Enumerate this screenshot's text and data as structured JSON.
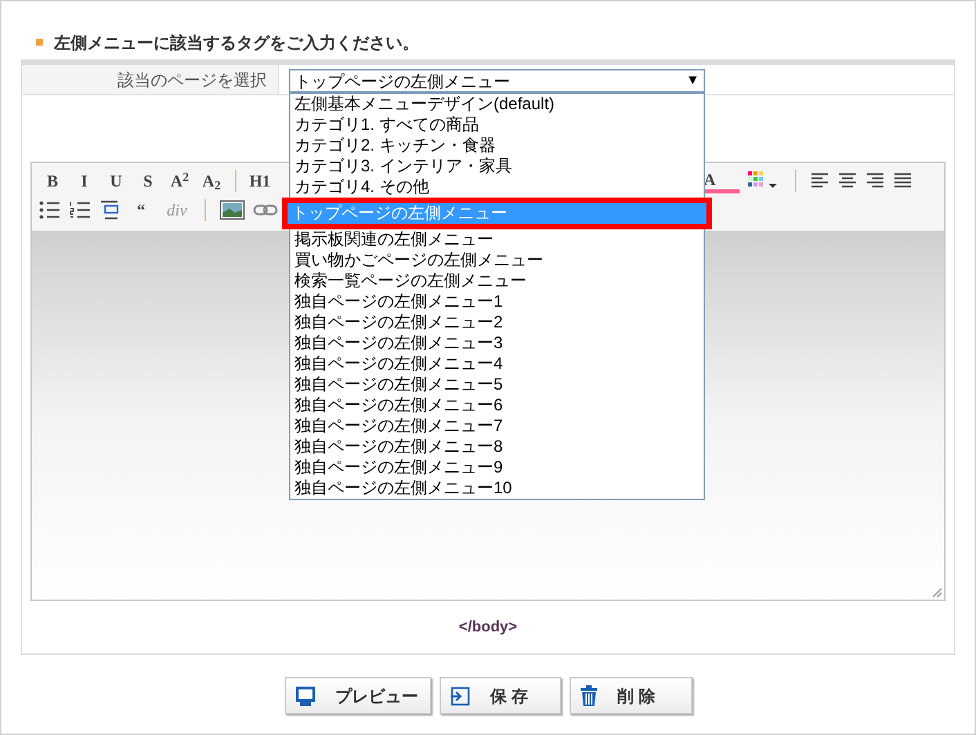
{
  "heading": "左側メニューに該当するタグをご入力ください。",
  "page_select": {
    "label": "該当のページを選択",
    "value": "トップページの左側メニュー",
    "arrow": "▼",
    "expanded": true,
    "options": [
      {
        "label": "左側基本メニューデザイン(default)",
        "selected": false
      },
      {
        "label": "カテゴリ1. すべての商品",
        "selected": false
      },
      {
        "label": "カテゴリ2. キッチン・食器",
        "selected": false
      },
      {
        "label": "カテゴリ3. インテリア・家具",
        "selected": false
      },
      {
        "label": "カテゴリ4. その他",
        "selected": false
      },
      {
        "label": "トップページの左側メニュー",
        "selected": true
      },
      {
        "label": "掲示板関連の左側メニュー",
        "selected": false
      },
      {
        "label": "買い物かごページの左側メニュー",
        "selected": false
      },
      {
        "label": "検索一覧ページの左側メニュー",
        "selected": false
      },
      {
        "label": "独自ページの左側メニュー1",
        "selected": false
      },
      {
        "label": "独自ページの左側メニュー2",
        "selected": false
      },
      {
        "label": "独自ページの左側メニュー3",
        "selected": false
      },
      {
        "label": "独自ページの左側メニュー4",
        "selected": false
      },
      {
        "label": "独自ページの左側メニュー5",
        "selected": false
      },
      {
        "label": "独自ページの左側メニュー6",
        "selected": false
      },
      {
        "label": "独自ページの左側メニュー7",
        "selected": false
      },
      {
        "label": "独自ページの左側メニュー8",
        "selected": false
      },
      {
        "label": "独自ページの左側メニュー9",
        "selected": false
      },
      {
        "label": "独自ページの左側メニュー10",
        "selected": false
      }
    ]
  },
  "toolbar_row_1": [
    {
      "kind": "text",
      "label": "B"
    },
    {
      "kind": "text",
      "label": "I"
    },
    {
      "kind": "text",
      "label": "U"
    },
    {
      "kind": "text",
      "label": "S"
    },
    {
      "kind": "text",
      "label": "A$^{2}$"
    },
    {
      "kind": "text",
      "label": "A$_{2}$"
    },
    {
      "kind": "separator"
    },
    {
      "kind": "text",
      "label": "H1"
    }
  ],
  "toolbar_row_1_right": [
    {
      "kind": "font-color",
      "label": "A"
    },
    {
      "kind": "palette"
    },
    {
      "kind": "separator"
    },
    {
      "kind": "align-left"
    },
    {
      "kind": "align-center"
    },
    {
      "kind": "align-right"
    },
    {
      "kind": "align-justify"
    }
  ],
  "toolbar_row_2": [
    {
      "kind": "bullet-list"
    },
    {
      "kind": "numbered-list"
    },
    {
      "kind": "indent"
    },
    {
      "kind": "text",
      "label": "“"
    },
    {
      "kind": "div",
      "label": "div"
    },
    {
      "kind": "separator"
    },
    {
      "kind": "image"
    },
    {
      "kind": "link"
    }
  ],
  "editor_footer": "</body>",
  "buttons": [
    {
      "kind": "preview",
      "label": "プレビュー"
    },
    {
      "kind": "save",
      "label": "保 存"
    },
    {
      "kind": "delete",
      "label": "削 除"
    }
  ]
}
